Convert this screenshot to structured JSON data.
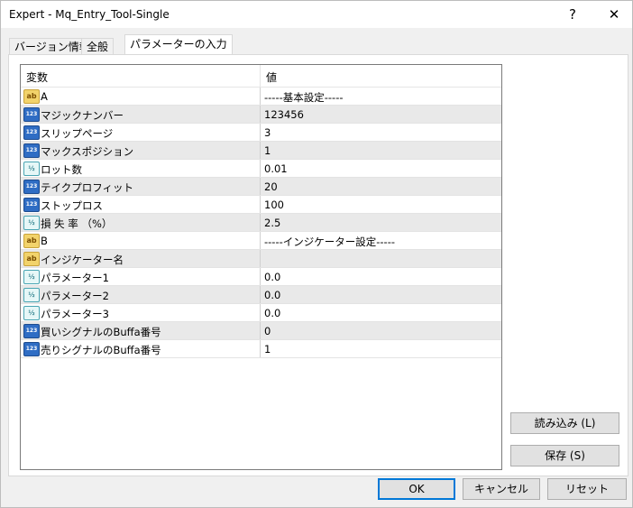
{
  "window": {
    "title": "Expert - Mq_Entry_Tool-Single",
    "help_label": "?",
    "close_label": "✕"
  },
  "tabs": [
    {
      "label": "バージョン情報"
    },
    {
      "label": "全般"
    },
    {
      "label": "パラメーターの入力"
    }
  ],
  "table": {
    "headers": {
      "variable": "変数",
      "value": "値"
    },
    "rows": [
      {
        "type": "string",
        "icon": "ab",
        "name": "A",
        "value": "-----基本設定-----"
      },
      {
        "type": "int",
        "icon": "123",
        "name": "マジックナンバー",
        "value": "123456"
      },
      {
        "type": "int",
        "icon": "123",
        "name": "スリップページ",
        "value": "3"
      },
      {
        "type": "int",
        "icon": "123",
        "name": "マックスポジション",
        "value": "1"
      },
      {
        "type": "double",
        "icon": "½",
        "name": "ロット数",
        "value": "0.01"
      },
      {
        "type": "int",
        "icon": "123",
        "name": "テイクプロフィット",
        "value": "20"
      },
      {
        "type": "int",
        "icon": "123",
        "name": "ストップロス",
        "value": "100"
      },
      {
        "type": "double",
        "icon": "½",
        "name": "損 失 率 （%）",
        "value": "2.5"
      },
      {
        "type": "string",
        "icon": "ab",
        "name": "B",
        "value": "-----インジケーター設定-----"
      },
      {
        "type": "string",
        "icon": "ab",
        "name": "インジケーター名",
        "value": ""
      },
      {
        "type": "double",
        "icon": "½",
        "name": "パラメーター1",
        "value": "0.0"
      },
      {
        "type": "double",
        "icon": "½",
        "name": "パラメーター2",
        "value": "0.0"
      },
      {
        "type": "double",
        "icon": "½",
        "name": "パラメーター3",
        "value": "0.0"
      },
      {
        "type": "int",
        "icon": "123",
        "name": "買いシグナルのBuffa番号",
        "value": "0"
      },
      {
        "type": "int",
        "icon": "123",
        "name": "売りシグナルのBuffa番号",
        "value": "1"
      }
    ]
  },
  "side_buttons": {
    "load": "読み込み (L)",
    "save": "保存 (S)"
  },
  "footer": {
    "ok": "OK",
    "cancel": "キャンセル",
    "reset": "リセット"
  }
}
